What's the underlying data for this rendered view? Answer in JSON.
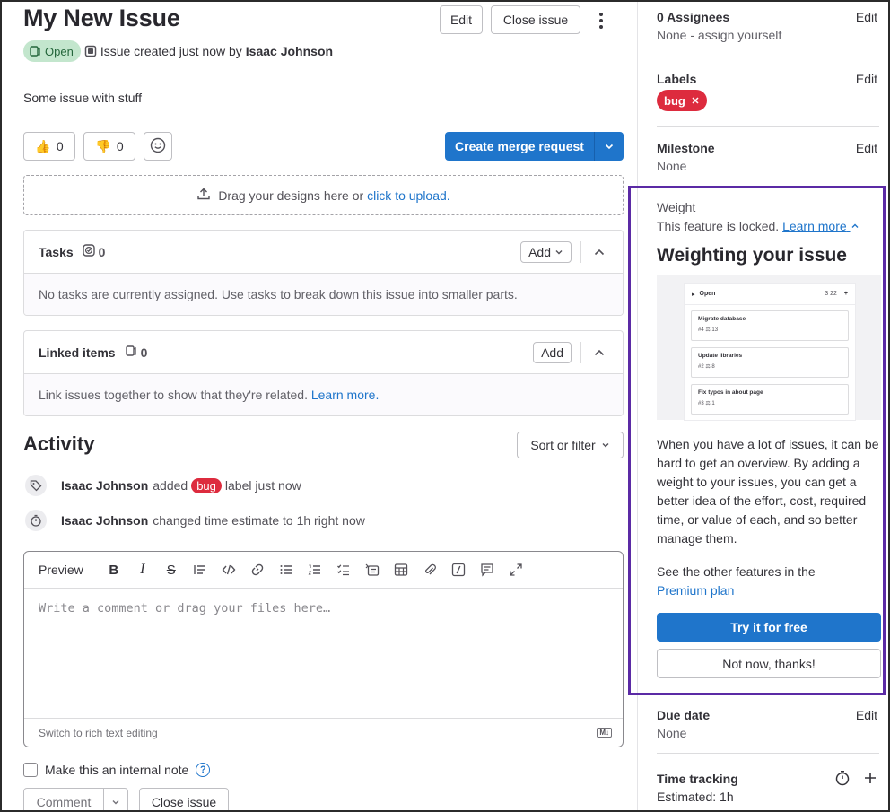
{
  "issue": {
    "title": "My New Issue",
    "edit_label": "Edit",
    "close_label": "Close issue",
    "status": "Open",
    "created_text": "Issue created just now by",
    "author": "Isaac Johnson",
    "description": "Some issue with stuff"
  },
  "reactions": {
    "thumbs_up_count": "0",
    "thumbs_down_count": "0"
  },
  "merge_request": {
    "label": "Create merge request"
  },
  "upload": {
    "text": "Drag your designs here or",
    "link": "click to upload."
  },
  "tasks": {
    "title": "Tasks",
    "count": "0",
    "add_label": "Add",
    "empty_text": "No tasks are currently assigned. Use tasks to break down this issue into smaller parts."
  },
  "linked": {
    "title": "Linked items",
    "count": "0",
    "add_label": "Add",
    "empty_text": "Link issues together to show that they're related.",
    "learn_more": "Learn more."
  },
  "activity": {
    "title": "Activity",
    "sort_label": "Sort or filter",
    "items": [
      {
        "user": "Isaac Johnson",
        "pre": "added",
        "label": "bug",
        "post": "label just now"
      },
      {
        "user": "Isaac Johnson",
        "text": "changed time estimate to 1h right now"
      }
    ]
  },
  "editor": {
    "preview_label": "Preview",
    "placeholder": "Write a comment or drag your files here…",
    "switch_label": "Switch to rich text editing",
    "md_badge": "M↓",
    "internal_note": "Make this an internal note",
    "comment_label": "Comment",
    "close_issue_label": "Close issue"
  },
  "sidebar": {
    "assignees": {
      "title": "0 Assignees",
      "edit": "Edit",
      "value": "None - assign yourself"
    },
    "labels": {
      "title": "Labels",
      "edit": "Edit",
      "label": "bug"
    },
    "milestone": {
      "title": "Milestone",
      "edit": "Edit",
      "value": "None"
    },
    "weight": {
      "title": "Weight",
      "locked_text": "This feature is locked.",
      "learn_more": "Learn more",
      "heading": "Weighting your issue",
      "body": "When you have a lot of issues, it can be hard to get an overview. By adding a weight to your issues, you can get a better idea of the effort, cost, required time, or value of each, and so better manage them.",
      "other_features": "See the other features in the",
      "premium": "Premium plan",
      "try_label": "Try it for free",
      "not_now_label": "Not now, thanks!",
      "preview": {
        "header": "Open",
        "header_counts": "3   22",
        "cards": [
          {
            "name": "Migrate database",
            "id": "#4",
            "weight": "13"
          },
          {
            "name": "Update libraries",
            "id": "#2",
            "weight": "8"
          },
          {
            "name": "Fix typos in about page",
            "id": "#3",
            "weight": "1"
          }
        ]
      }
    },
    "due_date": {
      "title": "Due date",
      "edit": "Edit",
      "value": "None"
    },
    "time_tracking": {
      "title": "Time tracking",
      "value": "Estimated: 1h"
    }
  },
  "colors": {
    "primary": "#1f75cb",
    "danger_label": "#dd2b3e",
    "open_badge_bg": "#c3e6cd",
    "highlight_border": "#5b2aa5"
  }
}
